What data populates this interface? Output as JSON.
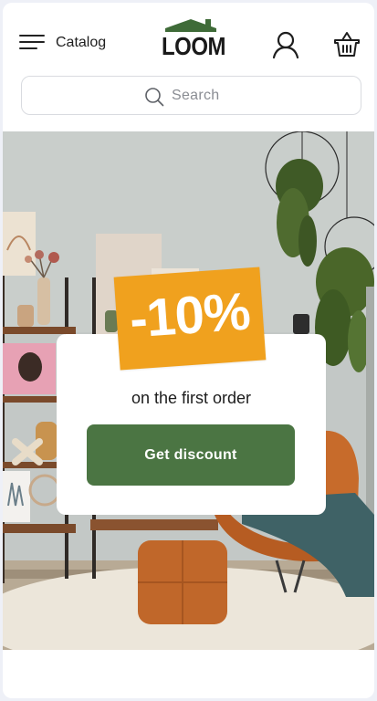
{
  "header": {
    "catalog_label": "Catalog",
    "brand": "LOOM",
    "icons": {
      "menu": "hamburger-menu-icon",
      "account": "user-icon",
      "cart": "shopping-basket-icon"
    }
  },
  "search": {
    "placeholder": "Search",
    "icon": "search-icon"
  },
  "promo": {
    "discount": "-10%",
    "text": "on the first order",
    "button_label": "Get discount"
  },
  "colors": {
    "accent_green": "#4b7543",
    "badge_orange": "#f0a11e",
    "logo_roof_green": "#3f6b38"
  }
}
